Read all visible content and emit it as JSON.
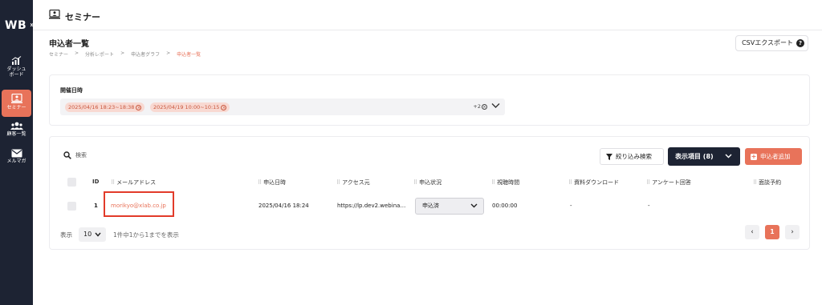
{
  "app": {
    "logo": "WB",
    "expand_icon": "double-chevron-right-icon"
  },
  "sidebar": {
    "items": [
      {
        "label": "ダッシュ\nボード",
        "icon": "chart-icon",
        "active": false
      },
      {
        "label": "セミナー",
        "icon": "presentation-icon",
        "active": true
      },
      {
        "label": "顧客一覧",
        "icon": "users-icon",
        "active": false
      },
      {
        "label": "メルマガ",
        "icon": "mail-icon",
        "active": false
      }
    ],
    "label_dashboard_1": "ダッシュ",
    "label_dashboard_2": "ボード",
    "label_seminar": "セミナー",
    "label_customers": "顧客一覧",
    "label_mailmag": "メルマガ"
  },
  "header": {
    "title": "セミナー"
  },
  "page": {
    "title": "申込者一覧",
    "breadcrumb": [
      "セミナー",
      "分析レポート",
      "申込者グラフ",
      "申込者一覧"
    ],
    "csv_button": "CSVエクスポート",
    "csv_help": "?"
  },
  "filter": {
    "label": "開催日時",
    "chips": [
      "2025/04/16 18:23~18:38",
      "2025/04/19 10:00~10:15"
    ],
    "more": "+2"
  },
  "toolbar": {
    "search_placeholder": "検索",
    "filter_button": "絞り込み検索",
    "display_button": "表示項目 (8)",
    "add_button": "申込者追加"
  },
  "table": {
    "columns": [
      "ID",
      "メールアドレス",
      "申込日時",
      "アクセス元",
      "申込状況",
      "視聴時間",
      "資料ダウンロード",
      "アンケート回答",
      "面談予約"
    ],
    "rows": [
      {
        "id": "1",
        "email": "morikyo@xlab.co.jp",
        "applied_at": "2025/04/16 18:24",
        "access_source": "https://lp.dev2.webina…",
        "status": "申込済",
        "watch_time": "00:00:00",
        "download": "-",
        "survey": "-",
        "meeting": ""
      }
    ]
  },
  "pagination": {
    "show_label": "表示",
    "per_page": "10",
    "range_text": "1件中1から1までを表示",
    "current_page": "1",
    "prev": "‹",
    "next": "›"
  },
  "colors": {
    "accent": "#e8735a",
    "sidebar": "#1d2333",
    "highlight": "#e23b2a"
  }
}
